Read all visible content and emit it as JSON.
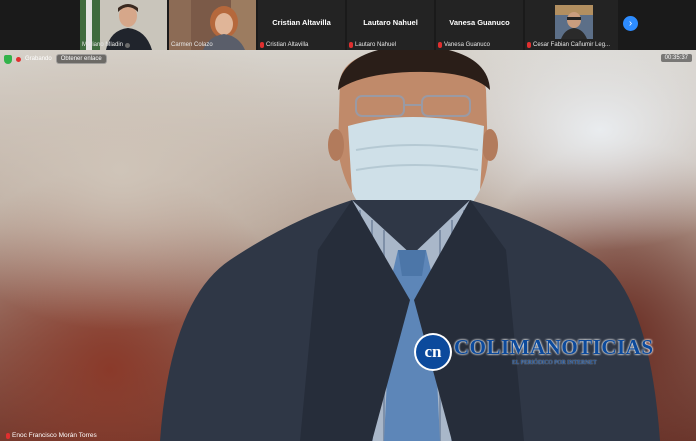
{
  "gallery": {
    "tiles": [
      {
        "name": "Mariano Mladin",
        "video": true,
        "mic_muted": false
      },
      {
        "name": "Carmen Colazo",
        "video": true,
        "mic_muted": false
      },
      {
        "name": "Cristian Altavilla",
        "video": false,
        "mic_muted": true
      },
      {
        "name": "Lautaro Nahuel",
        "video": false,
        "mic_muted": true
      },
      {
        "name": "Vanesa Guanuco",
        "video": false,
        "mic_muted": true
      },
      {
        "name": "Cesar Fabian Cañumir Leg...",
        "video": true,
        "mic_muted": true
      }
    ],
    "next_icon": "chevron-right-icon"
  },
  "meeting": {
    "recording_label": "Grabando",
    "copy_link_label": "Obtener enlace",
    "timer": "00:35:37",
    "active_speaker": "Enoc Francisco Morán Torres"
  },
  "watermark": {
    "brand": "COLIMANOTICIAS",
    "tagline": "EL PERIÓDICO POR INTERNET",
    "mark": "cn"
  },
  "colors": {
    "accent": "#2d8cff",
    "muted": "#e02f2f",
    "brand": "#0c4a9c",
    "secure": "#32b34a"
  }
}
